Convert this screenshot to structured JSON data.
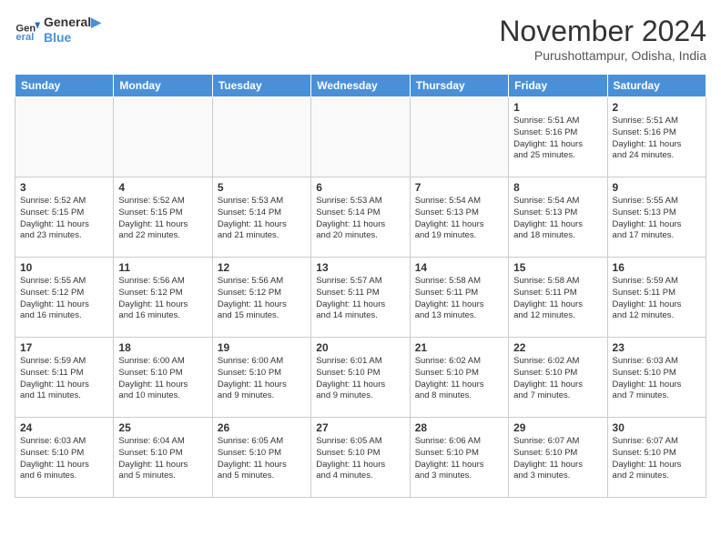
{
  "logo": {
    "line1": "General",
    "line2": "Blue"
  },
  "title": "November 2024",
  "location": "Purushottampur, Odisha, India",
  "days_of_week": [
    "Sunday",
    "Monday",
    "Tuesday",
    "Wednesday",
    "Thursday",
    "Friday",
    "Saturday"
  ],
  "weeks": [
    [
      {
        "day": "",
        "info": ""
      },
      {
        "day": "",
        "info": ""
      },
      {
        "day": "",
        "info": ""
      },
      {
        "day": "",
        "info": ""
      },
      {
        "day": "",
        "info": ""
      },
      {
        "day": "1",
        "info": "Sunrise: 5:51 AM\nSunset: 5:16 PM\nDaylight: 11 hours\nand 25 minutes."
      },
      {
        "day": "2",
        "info": "Sunrise: 5:51 AM\nSunset: 5:16 PM\nDaylight: 11 hours\nand 24 minutes."
      }
    ],
    [
      {
        "day": "3",
        "info": "Sunrise: 5:52 AM\nSunset: 5:15 PM\nDaylight: 11 hours\nand 23 minutes."
      },
      {
        "day": "4",
        "info": "Sunrise: 5:52 AM\nSunset: 5:15 PM\nDaylight: 11 hours\nand 22 minutes."
      },
      {
        "day": "5",
        "info": "Sunrise: 5:53 AM\nSunset: 5:14 PM\nDaylight: 11 hours\nand 21 minutes."
      },
      {
        "day": "6",
        "info": "Sunrise: 5:53 AM\nSunset: 5:14 PM\nDaylight: 11 hours\nand 20 minutes."
      },
      {
        "day": "7",
        "info": "Sunrise: 5:54 AM\nSunset: 5:13 PM\nDaylight: 11 hours\nand 19 minutes."
      },
      {
        "day": "8",
        "info": "Sunrise: 5:54 AM\nSunset: 5:13 PM\nDaylight: 11 hours\nand 18 minutes."
      },
      {
        "day": "9",
        "info": "Sunrise: 5:55 AM\nSunset: 5:13 PM\nDaylight: 11 hours\nand 17 minutes."
      }
    ],
    [
      {
        "day": "10",
        "info": "Sunrise: 5:55 AM\nSunset: 5:12 PM\nDaylight: 11 hours\nand 16 minutes."
      },
      {
        "day": "11",
        "info": "Sunrise: 5:56 AM\nSunset: 5:12 PM\nDaylight: 11 hours\nand 16 minutes."
      },
      {
        "day": "12",
        "info": "Sunrise: 5:56 AM\nSunset: 5:12 PM\nDaylight: 11 hours\nand 15 minutes."
      },
      {
        "day": "13",
        "info": "Sunrise: 5:57 AM\nSunset: 5:11 PM\nDaylight: 11 hours\nand 14 minutes."
      },
      {
        "day": "14",
        "info": "Sunrise: 5:58 AM\nSunset: 5:11 PM\nDaylight: 11 hours\nand 13 minutes."
      },
      {
        "day": "15",
        "info": "Sunrise: 5:58 AM\nSunset: 5:11 PM\nDaylight: 11 hours\nand 12 minutes."
      },
      {
        "day": "16",
        "info": "Sunrise: 5:59 AM\nSunset: 5:11 PM\nDaylight: 11 hours\nand 12 minutes."
      }
    ],
    [
      {
        "day": "17",
        "info": "Sunrise: 5:59 AM\nSunset: 5:11 PM\nDaylight: 11 hours\nand 11 minutes."
      },
      {
        "day": "18",
        "info": "Sunrise: 6:00 AM\nSunset: 5:10 PM\nDaylight: 11 hours\nand 10 minutes."
      },
      {
        "day": "19",
        "info": "Sunrise: 6:00 AM\nSunset: 5:10 PM\nDaylight: 11 hours\nand 9 minutes."
      },
      {
        "day": "20",
        "info": "Sunrise: 6:01 AM\nSunset: 5:10 PM\nDaylight: 11 hours\nand 9 minutes."
      },
      {
        "day": "21",
        "info": "Sunrise: 6:02 AM\nSunset: 5:10 PM\nDaylight: 11 hours\nand 8 minutes."
      },
      {
        "day": "22",
        "info": "Sunrise: 6:02 AM\nSunset: 5:10 PM\nDaylight: 11 hours\nand 7 minutes."
      },
      {
        "day": "23",
        "info": "Sunrise: 6:03 AM\nSunset: 5:10 PM\nDaylight: 11 hours\nand 7 minutes."
      }
    ],
    [
      {
        "day": "24",
        "info": "Sunrise: 6:03 AM\nSunset: 5:10 PM\nDaylight: 11 hours\nand 6 minutes."
      },
      {
        "day": "25",
        "info": "Sunrise: 6:04 AM\nSunset: 5:10 PM\nDaylight: 11 hours\nand 5 minutes."
      },
      {
        "day": "26",
        "info": "Sunrise: 6:05 AM\nSunset: 5:10 PM\nDaylight: 11 hours\nand 5 minutes."
      },
      {
        "day": "27",
        "info": "Sunrise: 6:05 AM\nSunset: 5:10 PM\nDaylight: 11 hours\nand 4 minutes."
      },
      {
        "day": "28",
        "info": "Sunrise: 6:06 AM\nSunset: 5:10 PM\nDaylight: 11 hours\nand 3 minutes."
      },
      {
        "day": "29",
        "info": "Sunrise: 6:07 AM\nSunset: 5:10 PM\nDaylight: 11 hours\nand 3 minutes."
      },
      {
        "day": "30",
        "info": "Sunrise: 6:07 AM\nSunset: 5:10 PM\nDaylight: 11 hours\nand 2 minutes."
      }
    ]
  ]
}
